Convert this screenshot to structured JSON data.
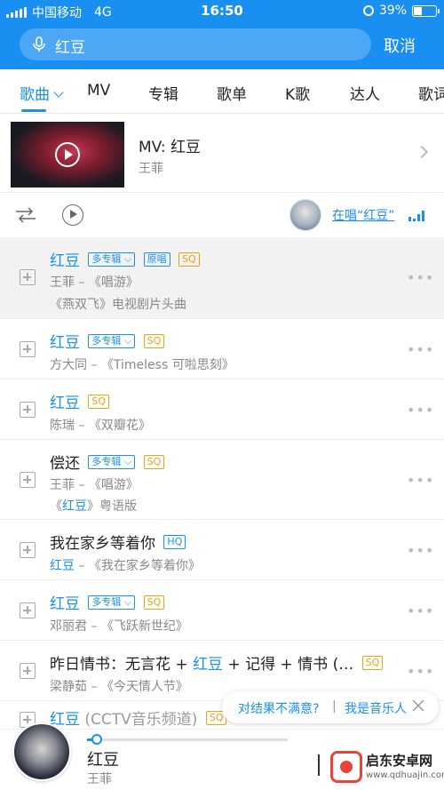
{
  "status_bar": {
    "carrier": "中国移动",
    "network": "4G",
    "time": "16:50",
    "battery": "39%",
    "battery_level": 0.39
  },
  "search": {
    "value": "红豆",
    "cancel_label": "取消"
  },
  "tabs": [
    {
      "label": "歌曲",
      "active": true
    },
    {
      "label": "MV"
    },
    {
      "label": "专辑"
    },
    {
      "label": "歌单"
    },
    {
      "label": "K歌"
    },
    {
      "label": "达人"
    },
    {
      "label": "歌词"
    }
  ],
  "mv": {
    "title": "MV: 红豆",
    "artist": "王菲"
  },
  "singing_link": "在唱“红豆”",
  "songs": [
    {
      "title": "红豆",
      "tags": [
        "多专辑",
        "原唱",
        "SQ"
      ],
      "subtitle": "王菲 – 《唱游》",
      "extra": "《燕双飞》电视剧片头曲"
    },
    {
      "title": "红豆",
      "tags": [
        "多专辑",
        "SQ"
      ],
      "subtitle": "方大同 – 《Timeless 可啦思刻》"
    },
    {
      "title": "红豆",
      "tags": [
        "SQ"
      ],
      "subtitle": "陈瑞 – 《双瓣花》"
    },
    {
      "title": "偿还",
      "tags": [
        "多专辑",
        "SQ"
      ],
      "subtitle": "王菲 – 《唱游》",
      "extra_pre": "《",
      "extra_hl": "红豆",
      "extra_post": "》粤语版"
    },
    {
      "title": "我在家乡等着你",
      "tags": [
        "HQ"
      ],
      "sub_hl": "红豆",
      "sub_post": " – 《我在家乡等着你》"
    },
    {
      "title": "红豆",
      "tags": [
        "多专辑",
        "SQ"
      ],
      "subtitle": "邓丽君 – 《飞跃新世纪》"
    },
    {
      "title_pre": "昨日情书：无言花 + ",
      "title_hl": "红豆",
      "title_post": " + 记得 + 情书 (…",
      "tags": [
        "SQ"
      ],
      "subtitle": "梁静茹 – 《今天情人节》"
    },
    {
      "title_hl": "红豆",
      "title_post": " (CCTV音乐频道)",
      "tags": [
        "SQ"
      ]
    }
  ],
  "feedback": {
    "text1": "对结果不满意?",
    "separator": "|",
    "text2": "我是音乐人"
  },
  "player": {
    "title": "红豆",
    "artist": "王菲",
    "progress": 0.05
  },
  "watermark": {
    "name": "启东安卓网",
    "url": "www.qdhuajin.com"
  },
  "colors": {
    "accent": "#1a8ff2",
    "gold_tag": "#e8a317"
  }
}
